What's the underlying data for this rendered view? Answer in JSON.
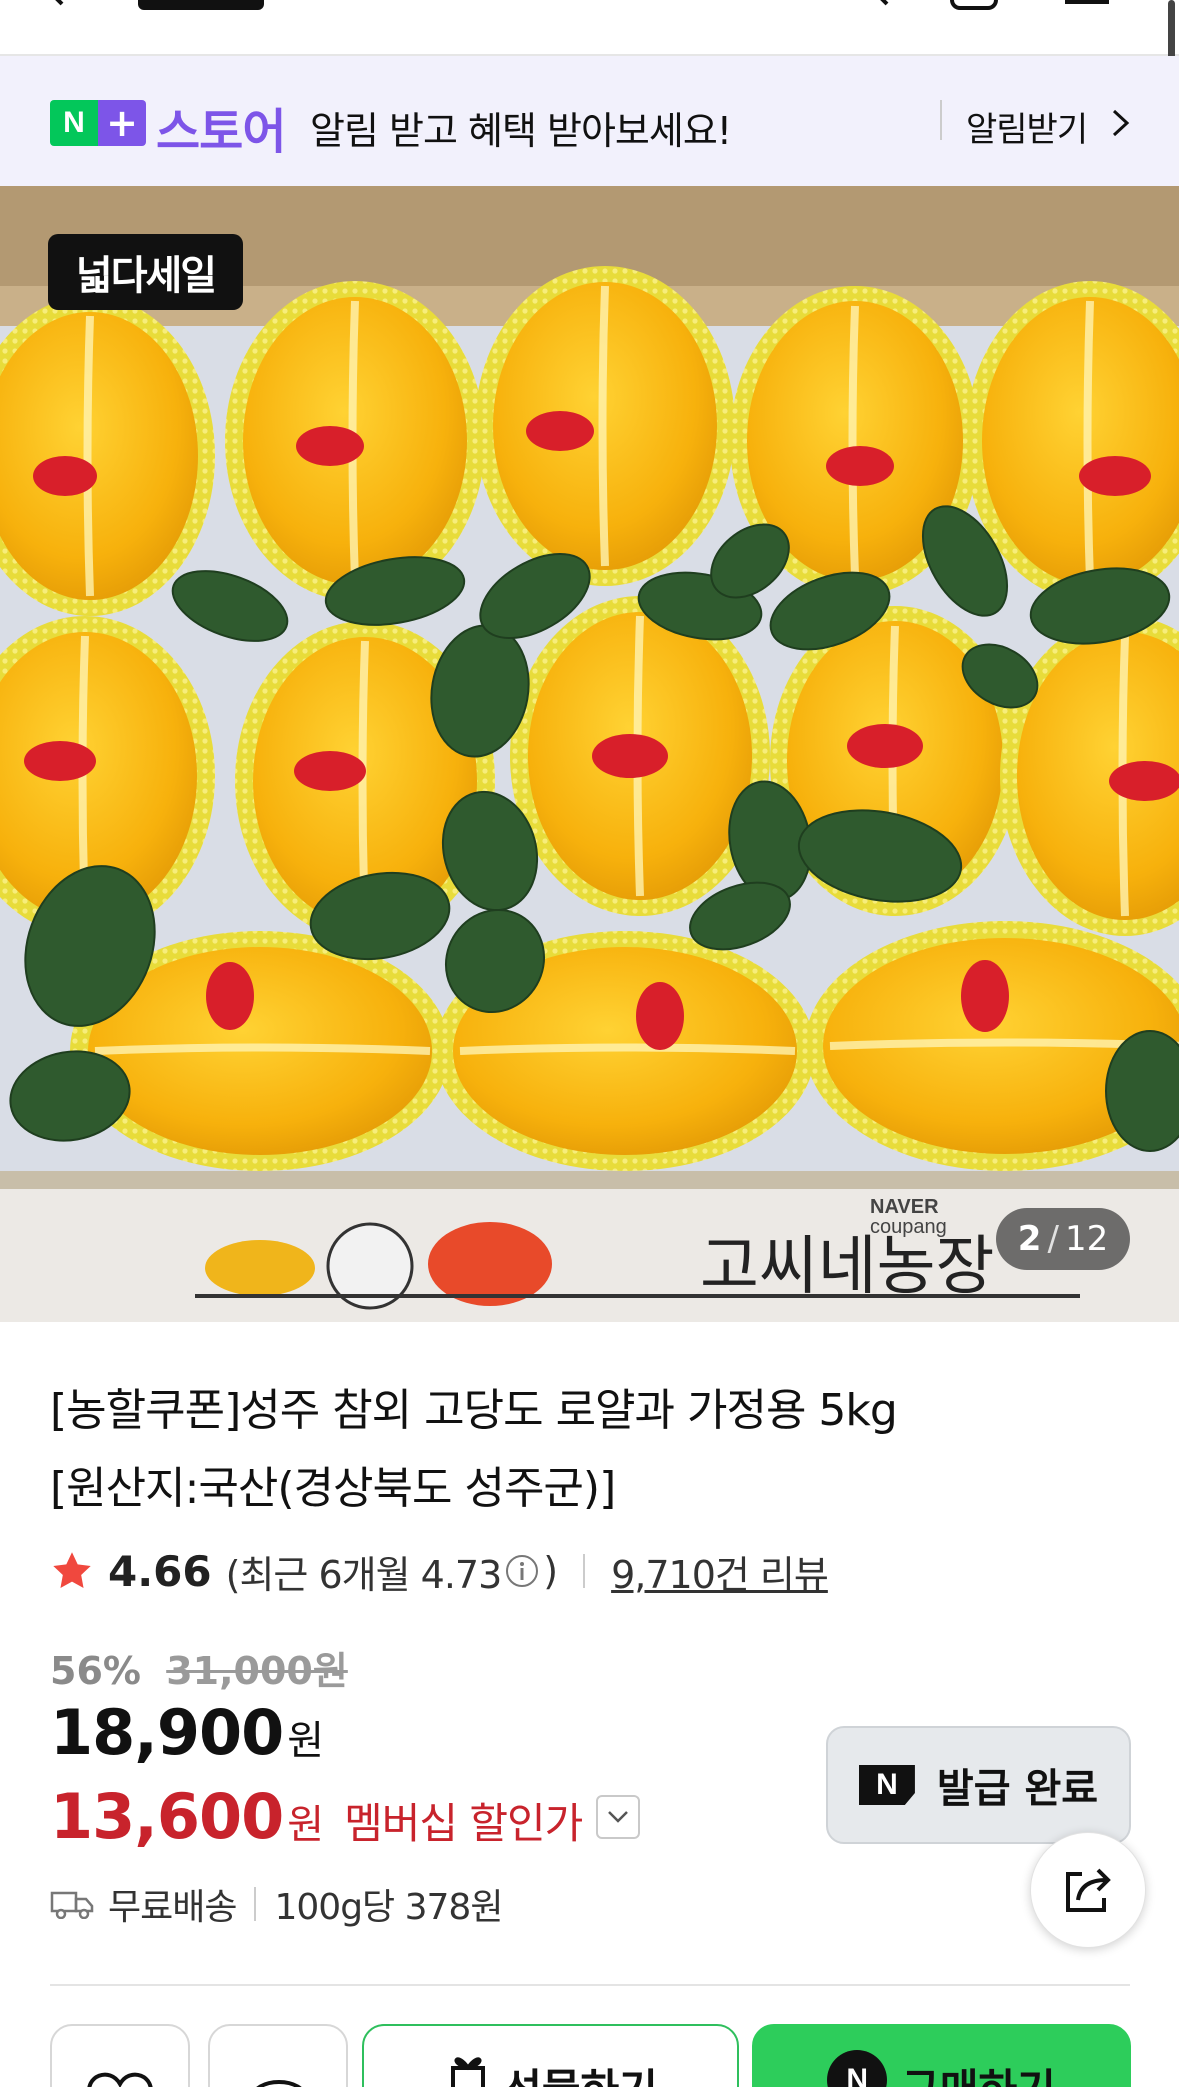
{
  "banner": {
    "brand_n": "N",
    "brand_plus": "+",
    "brand_store": "스토어",
    "message": "알림 받고 혜택 받아보세요!",
    "cta_label": "알림받기"
  },
  "hero": {
    "sale_badge": "넓다세일",
    "image_index": "2",
    "image_total": "12",
    "image_sep": "/",
    "box_brand_label": "고씨네농장",
    "box_top_label": "NAVER",
    "box_sub_label": "coupang"
  },
  "product": {
    "name_line1": "[농할쿠폰]성주 참외 고당도 로얄과 가정용 5kg",
    "name_line2": "[원산지:국산(경상북도 성주군)]",
    "rating_score": "4.66",
    "rating_recent_open": "(최근 6개월 4.73",
    "rating_recent_close": ")",
    "review_count": "9,710건 리뷰",
    "discount_pct": "56%",
    "original_price": "31,000원",
    "price": "18,900",
    "price_unit": "원",
    "member_price": "13,600",
    "member_unit": "원",
    "member_label": "멤버십 할인가",
    "coupon_label": "발급 완료",
    "shipping": "무료배송",
    "unit_price": "100g당 378원"
  },
  "bottom_bar": {
    "gift_label": "선물하기",
    "buy_label": "구매하기"
  },
  "colors": {
    "naver_green": "#03c75a",
    "store_purple": "#7d55e8",
    "member_red": "#c8232c",
    "star_red": "#f0483e",
    "buy_green": "#2dcd5b"
  },
  "icons": {
    "back": "arrow-left-icon",
    "search": "search-icon",
    "cart": "cart-icon",
    "menu": "menu-icon",
    "chevron": "chevron-right-icon",
    "star": "star-icon",
    "info": "info-icon",
    "dropdown": "chevron-down-icon",
    "share": "share-icon",
    "truck": "truck-icon",
    "wishlist": "heart-icon",
    "talk": "chat-icon",
    "gift": "gift-icon"
  }
}
